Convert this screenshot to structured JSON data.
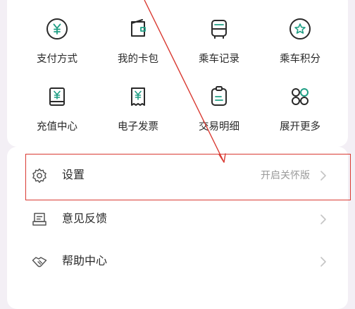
{
  "grid": [
    {
      "label": "支付方式",
      "icon": "yuan-coin-icon"
    },
    {
      "label": "我的卡包",
      "icon": "card-wallet-icon"
    },
    {
      "label": "乘车记录",
      "icon": "bus-icon"
    },
    {
      "label": "乘车积分",
      "icon": "star-badge-icon"
    },
    {
      "label": "充值中心",
      "icon": "recharge-book-icon"
    },
    {
      "label": "电子发票",
      "icon": "invoice-receipt-icon"
    },
    {
      "label": "交易明细",
      "icon": "clipboard-list-icon"
    },
    {
      "label": "展开更多",
      "icon": "four-circles-icon"
    }
  ],
  "menu": {
    "settings": {
      "label": "设置",
      "sub": "开启关怀版",
      "icon": "gear-icon"
    },
    "feedback": {
      "label": "意见反馈",
      "icon": "feedback-icon"
    },
    "help": {
      "label": "帮助中心",
      "icon": "handshake-icon"
    }
  },
  "colors": {
    "accent": "#1f9e84",
    "annotation": "#d93a32",
    "background": "#f3eff5"
  }
}
